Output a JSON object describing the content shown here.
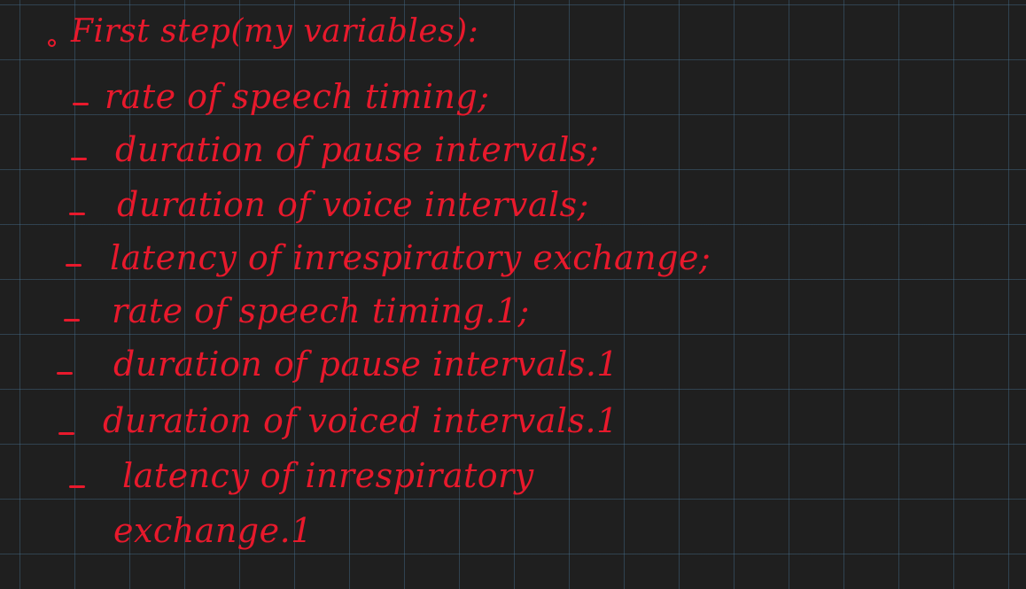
{
  "colors": {
    "ink": "#e8192c",
    "background": "#1f1f1f",
    "grid": "#466e8c"
  },
  "note": {
    "heading": "First step(my variables):",
    "items": [
      "rate of speech timing;",
      "duration of pause intervals;",
      "duration of voice intervals;",
      "latency of inrespiratory exchange;",
      "rate of speech timing.1;",
      "duration of pause intervals.1",
      "duration of voiced intervals.1",
      "latency of inrespiratory",
      "exchange.1"
    ]
  }
}
